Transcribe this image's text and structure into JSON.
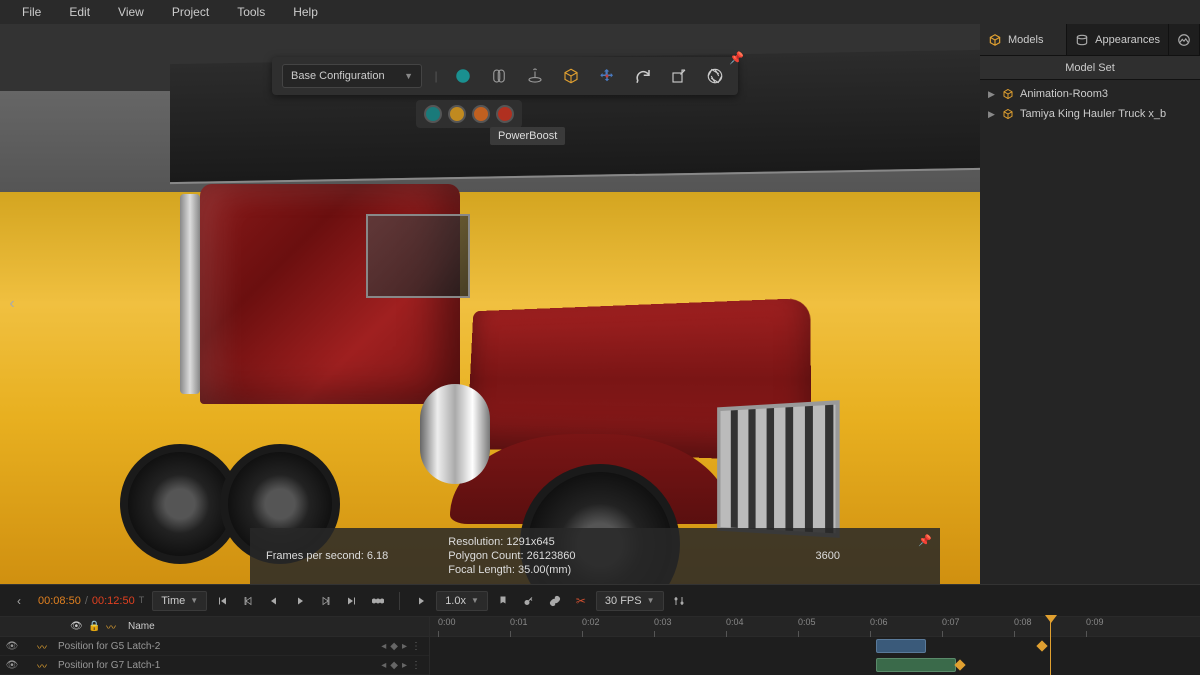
{
  "menu": [
    "File",
    "Edit",
    "View",
    "Project",
    "Tools",
    "Help"
  ],
  "config": {
    "label": "Base Configuration",
    "tooltip": "PowerBoost"
  },
  "colors": {
    "swatches": [
      "#1a7a7a",
      "#c08a20",
      "#c06020",
      "#b03020"
    ],
    "teal": "#1a9090",
    "amber": "#e0a030"
  },
  "stats": {
    "fps_label": "Frames per second: 6.18",
    "resolution": "Resolution: 1291x645",
    "polycount": "Polygon Count: 26123860",
    "focal": "Focal Length: 35.00(mm)",
    "frame": "3600"
  },
  "rightPanel": {
    "tabs": [
      "Models",
      "Appearances"
    ],
    "header": "Model Set",
    "items": [
      "Animation-Room3",
      "Tamiya King Hauler Truck x_b"
    ]
  },
  "timeline": {
    "current": "00:08:50",
    "total": "00:12:50",
    "unit_suffix": "T",
    "mode": "Time",
    "speed": "1.0x",
    "fps": "30 FPS",
    "name_header": "Name",
    "tracks": [
      "Position for G5 Latch-2",
      "Position for G7 Latch-1"
    ],
    "ticks": [
      "0:00",
      "0:01",
      "0:02",
      "0:03",
      "0:04",
      "0:05",
      "0:06",
      "0:07",
      "0:08",
      "0:09"
    ]
  }
}
